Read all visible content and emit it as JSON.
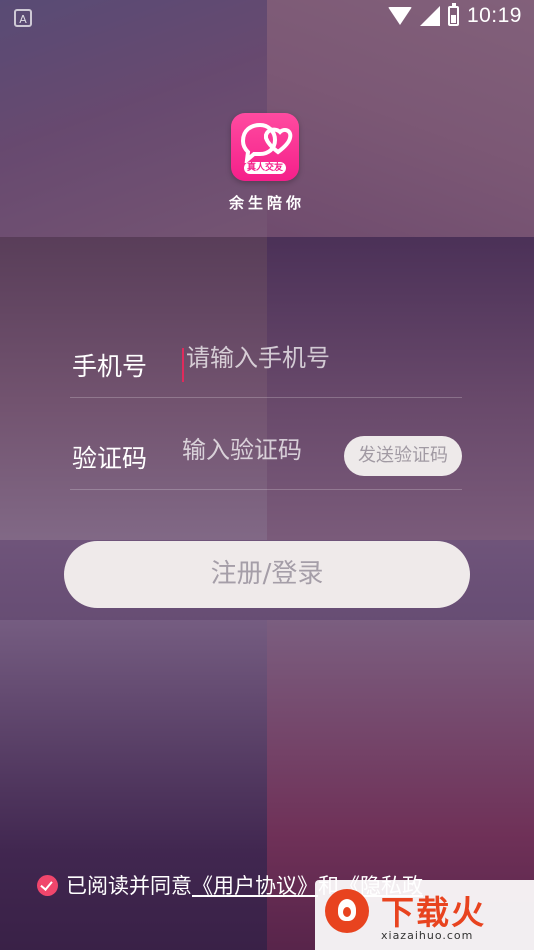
{
  "status_bar": {
    "time": "10:19",
    "left_indicator": "A",
    "icons": [
      "wifi-icon",
      "signal-icon",
      "battery-icon"
    ]
  },
  "app": {
    "logo_tag": "真人交友",
    "name": "余生陪你",
    "brand_color": "#f51f8a"
  },
  "form": {
    "phone_label": "手机号",
    "phone_placeholder": "请输入手机号",
    "code_label": "验证码",
    "code_placeholder": "输入验证码",
    "send_code_label": "发送验证码",
    "submit_label": "注册/登录"
  },
  "agreement": {
    "checked": true,
    "prefix": "已阅读并同意",
    "user_agreement": "《用户协议》",
    "conjunction": "和",
    "privacy_policy": "《隐私政"
  },
  "watermark": {
    "text": "下载火",
    "url": "xiazaihuo.com",
    "color": "#e8431f"
  }
}
